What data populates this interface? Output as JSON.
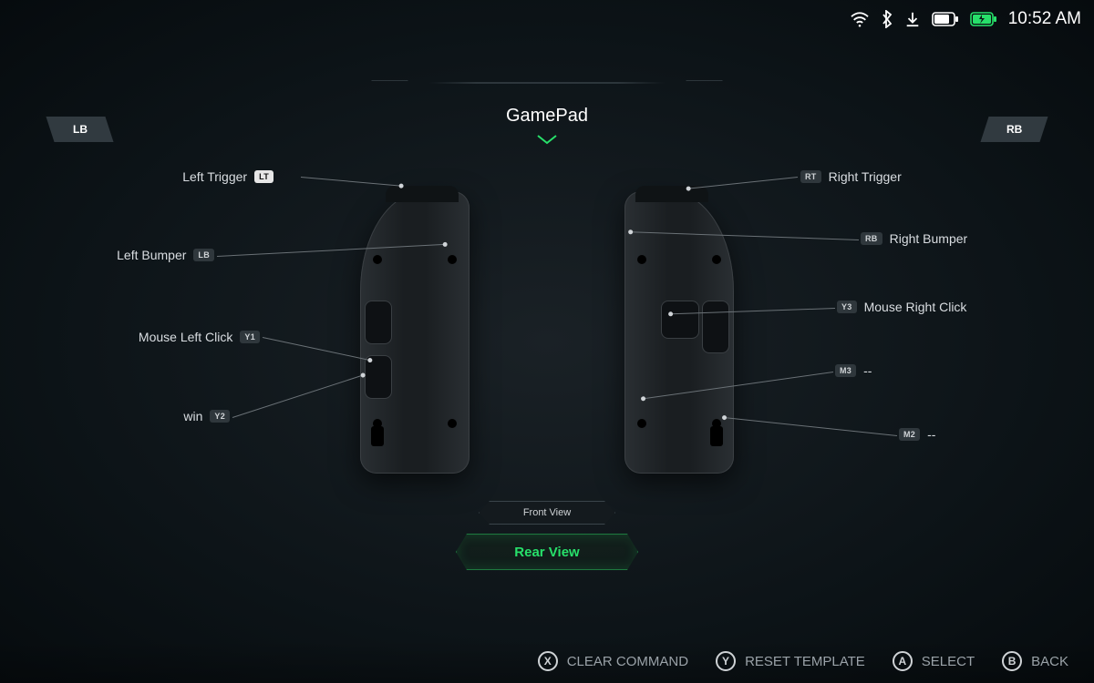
{
  "status": {
    "time": "10:52 AM"
  },
  "shoulders": {
    "left": "LB",
    "right": "RB"
  },
  "title": "GamePad",
  "labels": {
    "left": [
      {
        "text": "Left Trigger",
        "key": "LT",
        "keyStyle": "lt"
      },
      {
        "text": "Left Bumper",
        "key": "LB"
      },
      {
        "text": "Mouse Left Click",
        "key": "Y1"
      },
      {
        "text": "win",
        "key": "Y2"
      }
    ],
    "right": [
      {
        "text": "Right Trigger",
        "key": "RT"
      },
      {
        "text": "Right Bumper",
        "key": "RB"
      },
      {
        "text": "Mouse Right Click",
        "key": "Y3"
      },
      {
        "text": "--",
        "key": "M3"
      },
      {
        "text": "--",
        "key": "M2"
      }
    ]
  },
  "views": {
    "front": "Front View",
    "rear": "Rear View"
  },
  "actions": {
    "x": "CLEAR COMMAND",
    "y": "RESET TEMPLATE",
    "a": "SELECT",
    "b": "BACK"
  }
}
